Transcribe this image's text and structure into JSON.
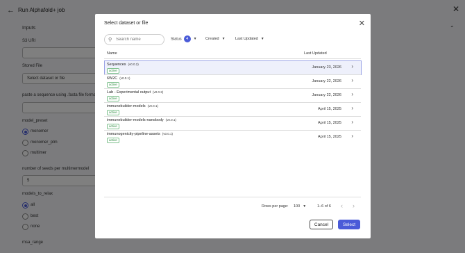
{
  "page": {
    "title": "Run Alphafold+ job",
    "sections": {
      "inputs": "Inputs",
      "s3_uri": "S3 URI",
      "stored_file": "Stored File",
      "stored_file_button": "Select dataset or file",
      "paste_sequence": "paste a sequence using .fasta file format",
      "model_preset": "model_preset",
      "model_preset_options": [
        "monomer",
        "monomer_ptm",
        "multimer"
      ],
      "seeds_label": "number of seeds per multimermodel",
      "seeds_value": "5",
      "models_to_relax": "models_to_relax",
      "relax_options": [
        "all",
        "best",
        "none"
      ],
      "msa_range": "msa_range"
    }
  },
  "modal": {
    "title": "Select dataset or file",
    "search_placeholder": "Search name",
    "filters": {
      "status_label": "Status",
      "status_count": "4",
      "created_label": "Created",
      "last_updated_label": "Last Updated"
    },
    "columns": {
      "name": "Name",
      "last_updated": "Last Updated"
    },
    "rows": [
      {
        "name": "Sequences",
        "version": "(v0.0.2)",
        "status": "active",
        "date": "January 23, 2026",
        "selected": true
      },
      {
        "name": "6W2C",
        "version": "(v0.0.1)",
        "status": "active",
        "date": "January 22, 2026"
      },
      {
        "name": "Lab - Experimental output",
        "version": "(v0.0.2)",
        "status": "active",
        "date": "January 22, 2026"
      },
      {
        "name": "immunebuilder-models",
        "version": "(v0.0.1)",
        "status": "active",
        "date": "April 15, 2025"
      },
      {
        "name": "immunebuilder-models-nanobody",
        "version": "(v0.0.1)",
        "status": "active",
        "date": "April 15, 2025"
      },
      {
        "name": "immunogenicity-pipeline-assets",
        "version": "(v0.0.1)",
        "status": "active",
        "date": "April 15, 2025"
      }
    ],
    "pagination": {
      "rows_per_page_label": "Rows per page:",
      "rows_per_page_value": "100",
      "range": "1–6 of 6"
    },
    "buttons": {
      "cancel": "Cancel",
      "select": "Select"
    }
  },
  "colors": {
    "accent": "#4a5bd8",
    "active_badge": "#2b8a3e",
    "selected_row_bg": "#eef0fb"
  }
}
